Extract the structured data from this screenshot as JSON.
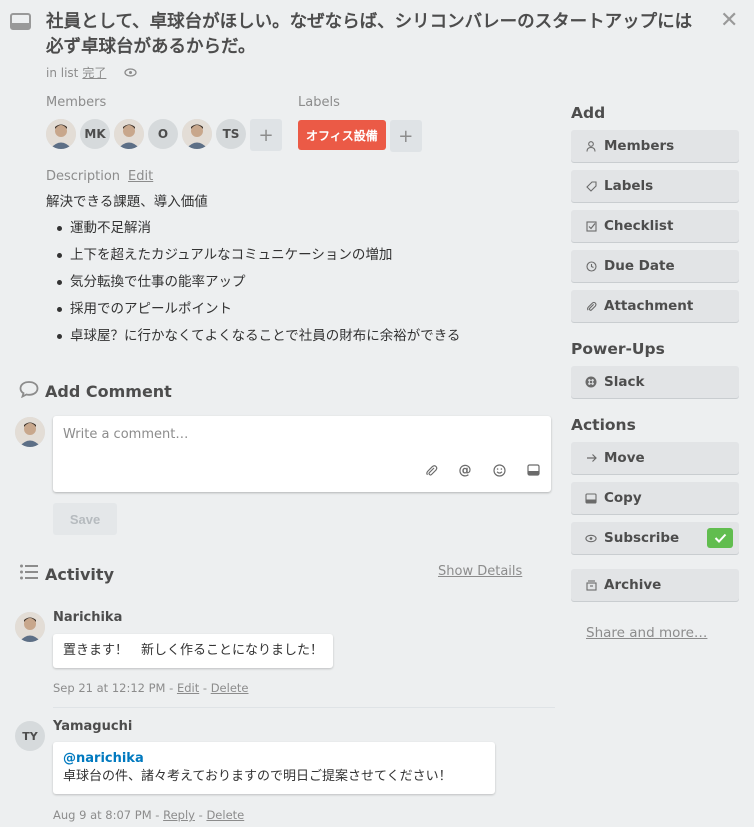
{
  "card": {
    "title": "社員として、卓球台がほしい。なぜならば、シリコンバレーのスタートアップには必ず卓球台があるからだ。",
    "in_list_prefix": "in list",
    "list_name": "完了"
  },
  "members": {
    "label": "Members",
    "avatars": [
      {
        "type": "photo",
        "initials": ""
      },
      {
        "type": "initials",
        "initials": "MK"
      },
      {
        "type": "photo",
        "initials": ""
      },
      {
        "type": "initials",
        "initials": "O"
      },
      {
        "type": "photo",
        "initials": ""
      },
      {
        "type": "initials",
        "initials": "TS"
      }
    ],
    "add_symbol": "+"
  },
  "labels": {
    "label": "Labels",
    "items": [
      {
        "text": "オフィス設備",
        "color": "#eb5a46"
      }
    ],
    "add_symbol": "+"
  },
  "description": {
    "label": "Description",
    "edit_label": "Edit",
    "heading": "解決できる課題、導入価値",
    "bullets": [
      "運動不足解消",
      "上下を超えたカジュアルなコミュニケーションの増加",
      "気分転換で仕事の能率アップ",
      "採用でのアピールポイント",
      "卓球屋？に行かなくてよくなることで社員の財布に余裕ができる"
    ]
  },
  "comment": {
    "heading": "Add Comment",
    "placeholder": "Write a comment…",
    "save_label": "Save"
  },
  "activity": {
    "heading": "Activity",
    "show_details": "Show Details",
    "items": [
      {
        "name": "Narichika",
        "mention": "",
        "text": "置きます！　新しく作ることになりました！",
        "date": "Sep 21 at 12:12 PM",
        "action1": "Edit",
        "action2": "Delete",
        "initials": ""
      },
      {
        "name": "Yamaguchi",
        "mention": "@narichika",
        "text": "卓球台の件、諸々考えておりますので明日ご提案させてください！",
        "date": "Aug 9 at 8:07 PM",
        "action1": "Reply",
        "action2": "Delete",
        "initials": "TY"
      }
    ]
  },
  "sidebar": {
    "add_heading": "Add",
    "add_items": [
      {
        "label": "Members",
        "icon": "person-icon"
      },
      {
        "label": "Labels",
        "icon": "tag-icon"
      },
      {
        "label": "Checklist",
        "icon": "checkbox-icon"
      },
      {
        "label": "Due Date",
        "icon": "clock-icon"
      },
      {
        "label": "Attachment",
        "icon": "paperclip-icon"
      }
    ],
    "powerups_heading": "Power-Ups",
    "powerups_items": [
      {
        "label": "Slack",
        "icon": "slack-icon"
      }
    ],
    "actions_heading": "Actions",
    "actions_items": [
      {
        "label": "Move",
        "icon": "arrow-right-icon"
      },
      {
        "label": "Copy",
        "icon": "card-icon"
      },
      {
        "label": "Subscribe",
        "icon": "eye-icon",
        "checked": true
      },
      {
        "label": "Archive",
        "icon": "archive-icon"
      }
    ],
    "share_label": "Share and more…"
  },
  "colors": {
    "background": "#edeff0",
    "label_red": "#eb5a46",
    "check_green": "#61bd4f",
    "mention_blue": "#0079bf"
  }
}
